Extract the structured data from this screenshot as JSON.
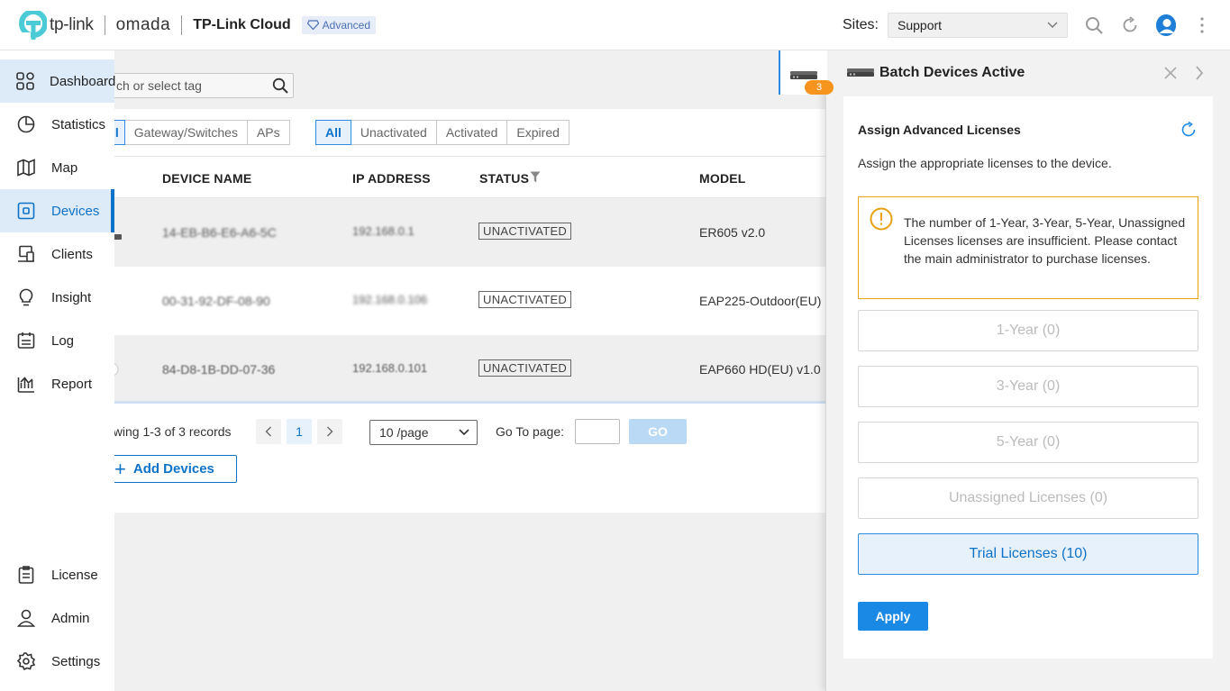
{
  "header": {
    "brand_text": "tp-link",
    "product_text": "omada",
    "cloud_title": "TP-Link Cloud",
    "badge": "Advanced",
    "sites_label": "Sites:",
    "site_value": "Support"
  },
  "sidebar": {
    "items": [
      {
        "label": "Dashboard",
        "icon": "dashboard-icon"
      },
      {
        "label": "Statistics",
        "icon": "pie-chart-icon"
      },
      {
        "label": "Map",
        "icon": "map-icon"
      },
      {
        "label": "Devices",
        "icon": "device-icon"
      },
      {
        "label": "Clients",
        "icon": "clients-icon"
      },
      {
        "label": "Insight",
        "icon": "lightbulb-icon"
      },
      {
        "label": "Log",
        "icon": "log-icon"
      },
      {
        "label": "Report",
        "icon": "report-icon"
      }
    ],
    "bottom_items": [
      {
        "label": "License",
        "icon": "license-icon"
      },
      {
        "label": "Admin",
        "icon": "user-icon"
      },
      {
        "label": "Settings",
        "icon": "gear-icon"
      }
    ]
  },
  "main": {
    "search_placeholder": "ch or select tag",
    "type_filters": [
      "ll",
      "Gateway/Switches",
      "APs"
    ],
    "status_filters": [
      "All",
      "Unactivated",
      "Activated",
      "Expired"
    ],
    "columns": [
      "DEVICE NAME",
      "IP ADDRESS",
      "STATUS",
      "MODEL"
    ],
    "rows": [
      {
        "name": "14-EB-B6-E6-A6-5C",
        "ip": "192.168.0.1",
        "status": "UNACTIVATED",
        "model": "ER605 v2.0"
      },
      {
        "name": "00-31-92-DF-08-90",
        "ip": "192.168.0.106",
        "status": "UNACTIVATED",
        "model": "EAP225-Outdoor(EU)"
      },
      {
        "name": "84-D8-1B-DD-07-36",
        "ip": "192.168.0.101",
        "status": "UNACTIVATED",
        "model": "EAP660 HD(EU) v1.0"
      }
    ],
    "pager_text": "owing 1-3 of 3 records",
    "current_page": "1",
    "per_page": "10 /page",
    "goto_label": "Go To page:",
    "go_label": "GO",
    "add_devices_label": "Add Devices"
  },
  "panel": {
    "tab_count": "3",
    "title": "Batch Devices Active",
    "card_title": "Assign Advanced Licenses",
    "description": "Assign the appropriate licenses to the device.",
    "warning": "The number of 1-Year, 3-Year, 5-Year, Unassigned Licenses licenses are insufficient. Please contact the main administrator to purchase licenses.",
    "licenses": [
      "1-Year (0)",
      "3-Year (0)",
      "5-Year (0)",
      "Unassigned Licenses (0)",
      "Trial Licenses (10)"
    ],
    "apply_label": "Apply"
  },
  "colors": {
    "accent": "#0e72c8",
    "warning": "#e8a314",
    "badge": "#f7941d",
    "brand_teal": "#4acbd6"
  }
}
